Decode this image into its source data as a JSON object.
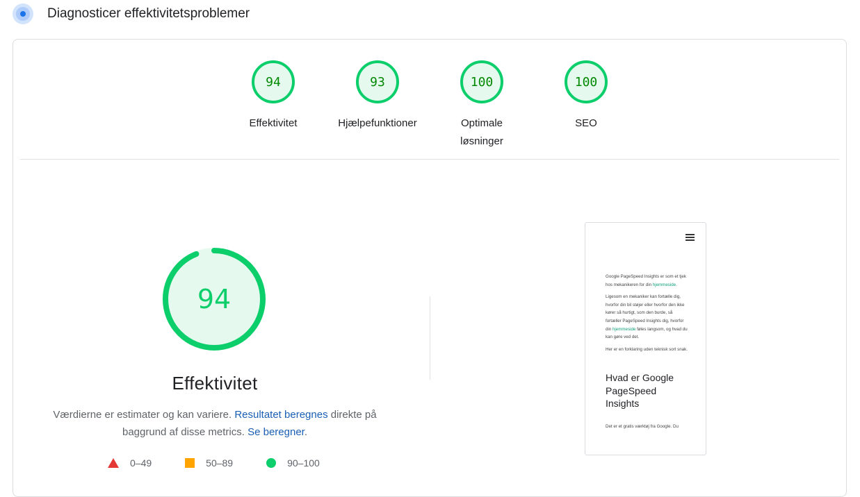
{
  "header": {
    "title": "Diagnosticer effektivitetsproblemer",
    "icon": "gauge-icon"
  },
  "categories": [
    {
      "score": "94",
      "label": "Effektivitet"
    },
    {
      "score": "93",
      "label": "Hjælpefunktioner"
    },
    {
      "score": "100",
      "label": "Optimale løsninger"
    },
    {
      "score": "100",
      "label": "SEO"
    }
  ],
  "main_gauge": {
    "score": "94",
    "fraction": 0.94,
    "title": "Effektivitet",
    "color": "#0cce6b"
  },
  "note": {
    "part1": "Værdierne er estimater og kan variere. ",
    "link1": "Resultatet beregnes",
    "part2": " direkte på baggrund af disse metrics. ",
    "link2": "Se beregner",
    "part3": "."
  },
  "legend": [
    {
      "icon": "triangle-red-icon",
      "label": "0–49"
    },
    {
      "icon": "square-orange-icon",
      "label": "50–89"
    },
    {
      "icon": "circle-green-icon",
      "label": "90–100"
    }
  ],
  "screenshot": {
    "p1": "Google PageSpeed Insights er som et tjek hos mekanikeren for din ",
    "p1_link": "hjemmeside",
    "p1_end": ".",
    "p2": "Ligesom en mekaniker kan fortælle dig, hvorfor din bil støjer eller hvorfor den ikke kører så hurtigt, som den burde, så fortæller PageSpeed Insights dig, hvorfor din ",
    "p2_link": "hjemmeside",
    "p2_end": " føles langsom, og hvad du kan gøre ved det.",
    "p3": "Her er en forklaring uden teknisk sort snak.",
    "heading": "Hvad er Google PageSpeed Insights",
    "p4": "Det er et gratis værktøj fra Google. Du"
  },
  "colors": {
    "pass": "#0cce6b",
    "average": "#ffa400",
    "fail": "#e53935",
    "link": "#1a5fb4"
  }
}
